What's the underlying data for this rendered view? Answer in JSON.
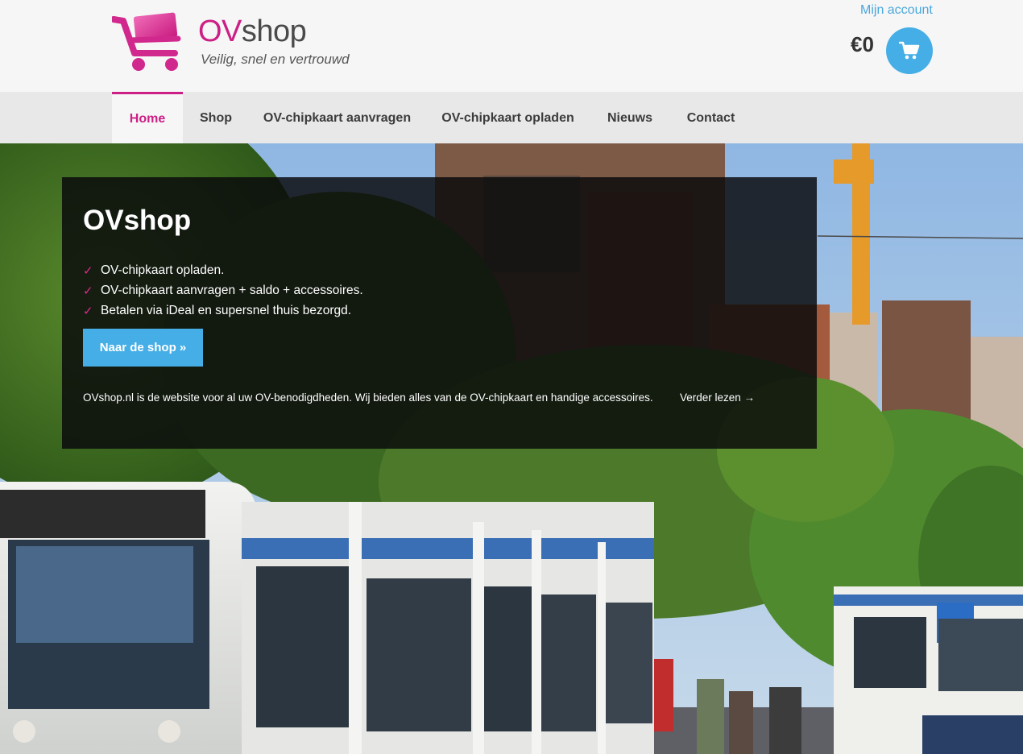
{
  "header": {
    "brand": {
      "part1": "OV",
      "part2": "shop"
    },
    "tagline": "Veilig, snel en vertrouwd",
    "account_link": "Mijn account",
    "cart_total": "€0",
    "cart_icon": "shopping-cart-icon",
    "logo_icon": "cart-logo-icon"
  },
  "nav": {
    "items": [
      {
        "label": "Home",
        "active": true
      },
      {
        "label": "Shop"
      },
      {
        "label": "OV-chipkaart aanvragen"
      },
      {
        "label": "OV-chipkaart opladen"
      },
      {
        "label": "Nieuws"
      },
      {
        "label": "Contact"
      }
    ]
  },
  "hero": {
    "title": "OVshop",
    "features": [
      "OV-chipkaart opladen.",
      "OV-chipkaart aanvragen + saldo + accessoires.",
      "Betalen via iDeal en supersnel thuis bezorgd."
    ],
    "check_glyph": "✓",
    "cta": "Naar de shop »",
    "description": "OVshop.nl is de website voor al uw OV-benodigdheden. Wij bieden alles van de OV-chipkaart en handige accessoires.",
    "read_more": "Verder lezen →"
  },
  "colors": {
    "brand_pink": "#cc1f85",
    "accent_blue": "#45aee6",
    "nav_bg": "#e8e8e8",
    "header_bg": "#f6f6f6"
  }
}
